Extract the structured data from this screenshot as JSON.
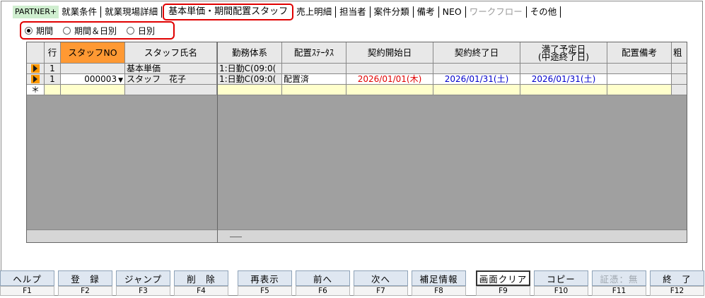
{
  "tabs": [
    {
      "label": "PARTNER+"
    },
    {
      "label": "就業条件"
    },
    {
      "label": "就業現場詳細"
    },
    {
      "label": "基本単価・期間配置スタッフ"
    },
    {
      "label": "売上明細"
    },
    {
      "label": "担当者"
    },
    {
      "label": "案件分類"
    },
    {
      "label": "備考"
    },
    {
      "label": "NEO"
    },
    {
      "label": "ワークフロー"
    },
    {
      "label": "その他"
    }
  ],
  "period": {
    "options": [
      "期間",
      "期間＆日別",
      "日別"
    ],
    "selected": "期間"
  },
  "grid": {
    "headers": {
      "row": "行",
      "staff_no": "スタッフNO",
      "staff_name": "スタッフ氏名",
      "work": "勤務体系",
      "status": "配置ｽﾃｰﾀｽ",
      "start": "契約開始日",
      "end": "契約終了日",
      "planned_line1": "満了予定日",
      "planned_line2": "(中途終了日)",
      "note": "配置備考",
      "extra": "粗"
    },
    "rows": [
      {
        "row": "1",
        "staff_no": "",
        "staff_name": "基本単価",
        "work": "1:日勤C(09:0(",
        "status": "",
        "start": "",
        "end": "",
        "planned": "",
        "note": ""
      },
      {
        "row": "1",
        "staff_no": "000003",
        "staff_name": "スタッフ　花子",
        "work": "1:日勤C(09:0(",
        "status": "配置済",
        "start": "2026/01/01(木)",
        "end": "2026/01/31(土)",
        "planned": "2026/01/31(土)",
        "note": ""
      }
    ],
    "new_row_marker": "＊"
  },
  "fkeys": [
    {
      "label": "ヘルプ",
      "key": "F1"
    },
    {
      "label": "登　録",
      "key": "F2"
    },
    {
      "label": "ジャンプ",
      "key": "F3"
    },
    {
      "label": "削　除",
      "key": "F4"
    },
    {
      "label": "再表示",
      "key": "F5"
    },
    {
      "label": "前へ",
      "key": "F6"
    },
    {
      "label": "次へ",
      "key": "F7"
    },
    {
      "label": "補足情報",
      "key": "F8"
    },
    {
      "label": "画面クリア",
      "key": "F9"
    },
    {
      "label": "コピー",
      "key": "F10"
    },
    {
      "label": "証憑：無",
      "key": "F11"
    },
    {
      "label": "終　了",
      "key": "F12"
    }
  ],
  "colors": {
    "accent_red": "#e00000",
    "staff_no_header": "#ff9933",
    "selector_arrow": "#ff9900",
    "date_red": "#e00000",
    "date_blue": "#0000cc",
    "new_row": "#ffffcc"
  }
}
